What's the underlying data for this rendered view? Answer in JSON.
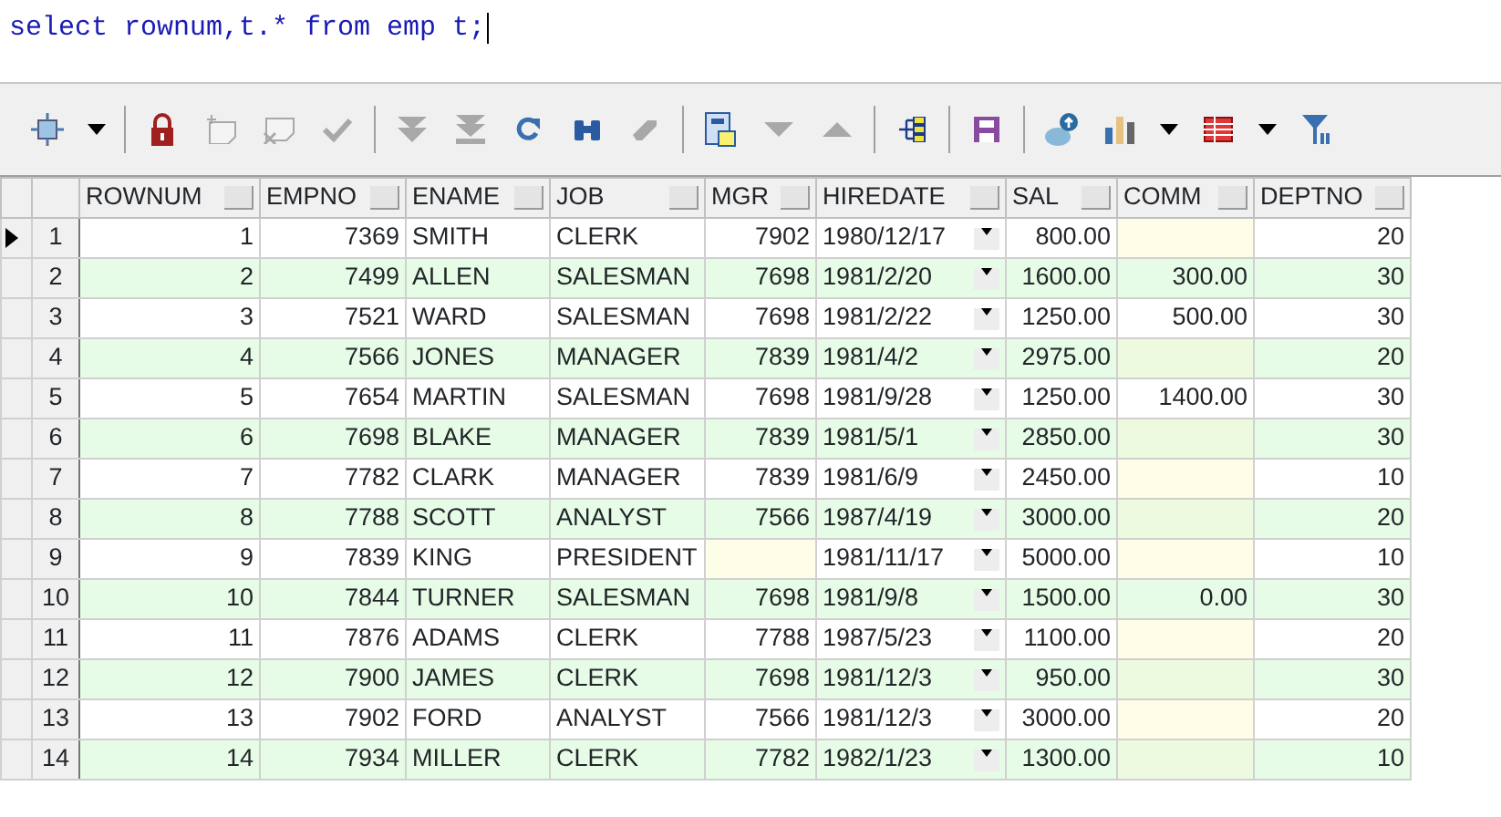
{
  "editor": {
    "sql": "select rownum,t.* from emp t;"
  },
  "toolbar": [
    {
      "kind": "select-mode",
      "disabled": false
    },
    {
      "kind": "caret",
      "disabled": false
    },
    {
      "kind": "separator"
    },
    {
      "kind": "lock",
      "disabled": false
    },
    {
      "kind": "new-record",
      "disabled": true
    },
    {
      "kind": "delete-record",
      "disabled": true
    },
    {
      "kind": "check",
      "disabled": true
    },
    {
      "kind": "separator"
    },
    {
      "kind": "next-page",
      "disabled": true
    },
    {
      "kind": "last-page",
      "disabled": true
    },
    {
      "kind": "refresh",
      "disabled": false
    },
    {
      "kind": "find",
      "disabled": false
    },
    {
      "kind": "eraser",
      "disabled": true
    },
    {
      "kind": "separator"
    },
    {
      "kind": "form-view",
      "disabled": false
    },
    {
      "kind": "down",
      "disabled": true
    },
    {
      "kind": "up",
      "disabled": true
    },
    {
      "kind": "separator"
    },
    {
      "kind": "tree",
      "disabled": false
    },
    {
      "kind": "separator"
    },
    {
      "kind": "save",
      "disabled": false
    },
    {
      "kind": "separator"
    },
    {
      "kind": "export",
      "disabled": false
    },
    {
      "kind": "chart",
      "disabled": false
    },
    {
      "kind": "caret",
      "disabled": false
    },
    {
      "kind": "table",
      "disabled": false
    },
    {
      "kind": "caret",
      "disabled": false
    },
    {
      "kind": "filter",
      "disabled": false
    }
  ],
  "grid": {
    "columns": [
      {
        "label": "ROWNUM",
        "kind": "number"
      },
      {
        "label": "EMPNO",
        "kind": "number"
      },
      {
        "label": "ENAME",
        "kind": "text"
      },
      {
        "label": "JOB",
        "kind": "text"
      },
      {
        "label": "MGR",
        "kind": "number"
      },
      {
        "label": "HIREDATE",
        "kind": "date"
      },
      {
        "label": "SAL",
        "kind": "number"
      },
      {
        "label": "COMM",
        "kind": "number"
      },
      {
        "label": "DEPTNO",
        "kind": "number"
      }
    ],
    "rows": [
      {
        "current": true,
        "row_number": "1",
        "cells": [
          "1",
          "7369",
          "SMITH",
          "CLERK",
          "7902",
          "1980/12/17",
          "800.00",
          null,
          "20"
        ]
      },
      {
        "current": false,
        "row_number": "2",
        "cells": [
          "2",
          "7499",
          "ALLEN",
          "SALESMAN",
          "7698",
          "1981/2/20",
          "1600.00",
          "300.00",
          "30"
        ]
      },
      {
        "current": false,
        "row_number": "3",
        "cells": [
          "3",
          "7521",
          "WARD",
          "SALESMAN",
          "7698",
          "1981/2/22",
          "1250.00",
          "500.00",
          "30"
        ]
      },
      {
        "current": false,
        "row_number": "4",
        "cells": [
          "4",
          "7566",
          "JONES",
          "MANAGER",
          "7839",
          "1981/4/2",
          "2975.00",
          null,
          "20"
        ]
      },
      {
        "current": false,
        "row_number": "5",
        "cells": [
          "5",
          "7654",
          "MARTIN",
          "SALESMAN",
          "7698",
          "1981/9/28",
          "1250.00",
          "1400.00",
          "30"
        ]
      },
      {
        "current": false,
        "row_number": "6",
        "cells": [
          "6",
          "7698",
          "BLAKE",
          "MANAGER",
          "7839",
          "1981/5/1",
          "2850.00",
          null,
          "30"
        ]
      },
      {
        "current": false,
        "row_number": "7",
        "cells": [
          "7",
          "7782",
          "CLARK",
          "MANAGER",
          "7839",
          "1981/6/9",
          "2450.00",
          null,
          "10"
        ]
      },
      {
        "current": false,
        "row_number": "8",
        "cells": [
          "8",
          "7788",
          "SCOTT",
          "ANALYST",
          "7566",
          "1987/4/19",
          "3000.00",
          null,
          "20"
        ]
      },
      {
        "current": false,
        "row_number": "9",
        "cells": [
          "9",
          "7839",
          "KING",
          "PRESIDENT",
          null,
          "1981/11/17",
          "5000.00",
          null,
          "10"
        ]
      },
      {
        "current": false,
        "row_number": "10",
        "cells": [
          "10",
          "7844",
          "TURNER",
          "SALESMAN",
          "7698",
          "1981/9/8",
          "1500.00",
          "0.00",
          "30"
        ]
      },
      {
        "current": false,
        "row_number": "11",
        "cells": [
          "11",
          "7876",
          "ADAMS",
          "CLERK",
          "7788",
          "1987/5/23",
          "1100.00",
          null,
          "20"
        ]
      },
      {
        "current": false,
        "row_number": "12",
        "cells": [
          "12",
          "7900",
          "JAMES",
          "CLERK",
          "7698",
          "1981/12/3",
          "950.00",
          null,
          "30"
        ]
      },
      {
        "current": false,
        "row_number": "13",
        "cells": [
          "13",
          "7902",
          "FORD",
          "ANALYST",
          "7566",
          "1981/12/3",
          "3000.00",
          null,
          "20"
        ]
      },
      {
        "current": false,
        "row_number": "14",
        "cells": [
          "14",
          "7934",
          "MILLER",
          "CLERK",
          "7782",
          "1982/1/23",
          "1300.00",
          null,
          "10"
        ]
      }
    ]
  }
}
